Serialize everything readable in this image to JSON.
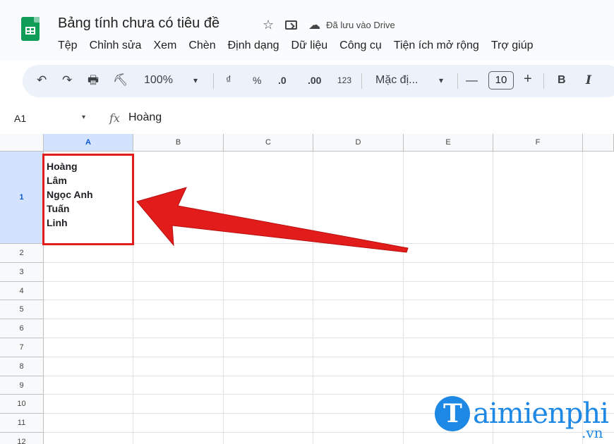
{
  "app": {
    "doc_title": "Bảng tính chưa có tiêu đề",
    "saved_status": "Đã lưu vào Drive",
    "star_icon": "star-icon",
    "folder_icon": "move-to-folder-icon",
    "cloud_icon": "cloud-saved-icon"
  },
  "menu": [
    "Tệp",
    "Chỉnh sửa",
    "Xem",
    "Chèn",
    "Định dạng",
    "Dữ liệu",
    "Công cụ",
    "Tiện ích mở rộng",
    "Trợ giúp"
  ],
  "toolbar": {
    "undo": "↶",
    "redo": "↷",
    "print": "🖶",
    "paint_format": "⛏",
    "zoom": "100%",
    "zoom_arrow": "▾",
    "currency": "₫",
    "percent": "%",
    "decrease_decimal": ".0",
    "increase_decimal": ".00",
    "number_format": "123",
    "font": "Mặc đị...",
    "font_arrow": "▾",
    "minus": "—",
    "font_size": "10",
    "plus": "+",
    "bold": "B",
    "italic": "I"
  },
  "formula_bar": {
    "cell_ref": "A1",
    "dropdown_icon": "▾",
    "fx": "fx",
    "content": "Hoàng"
  },
  "columns": [
    "A",
    "B",
    "C",
    "D",
    "E",
    "F"
  ],
  "rows": [
    "1",
    "2",
    "3",
    "4",
    "5",
    "6",
    "7",
    "8",
    "9",
    "10",
    "11",
    "12"
  ],
  "cells": {
    "A1": [
      "Hoàng",
      "Lâm",
      "Ngọc Anh",
      "Tuấn",
      "Linh"
    ]
  },
  "annotation": {
    "highlight_color": "#e21b1b",
    "arrow_color": "#e21b1b"
  },
  "watermark": {
    "main": "aimienphi",
    "suffix": ".vn",
    "color": "#1e88e5"
  }
}
